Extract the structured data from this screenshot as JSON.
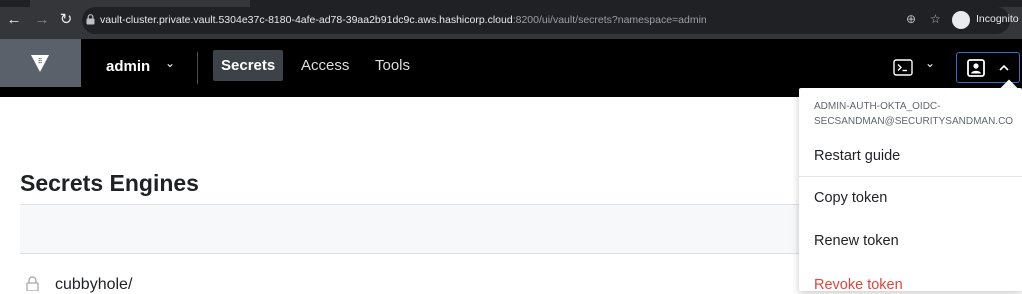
{
  "browser": {
    "url_host": "vault-cluster.private.vault.5304e37c-8180-4afe-ad78-39aa2b91dc9c.aws.hashicorp.cloud",
    "url_rest": ":8200/ui/vault/secrets?namespace=admin",
    "profile_label": "Incognito"
  },
  "header": {
    "namespace": "admin",
    "nav": [
      "Secrets",
      "Access",
      "Tools"
    ]
  },
  "page": {
    "title": "Secrets Engines",
    "first_engine": "cubbyhole/"
  },
  "user_menu": {
    "identity_line1": "ADMIN-AUTH-OKTA_OIDC-",
    "identity_line2": "SECSANDMAN@SECURITYSANDMAN.CO",
    "items": [
      "Restart guide",
      "Copy token",
      "Renew token",
      "Revoke token"
    ]
  },
  "colors": {
    "header_bg": "#000000",
    "active_nav": "#3d4148",
    "revoke": "#e0443e",
    "focus_border": "#2f6fd6"
  }
}
